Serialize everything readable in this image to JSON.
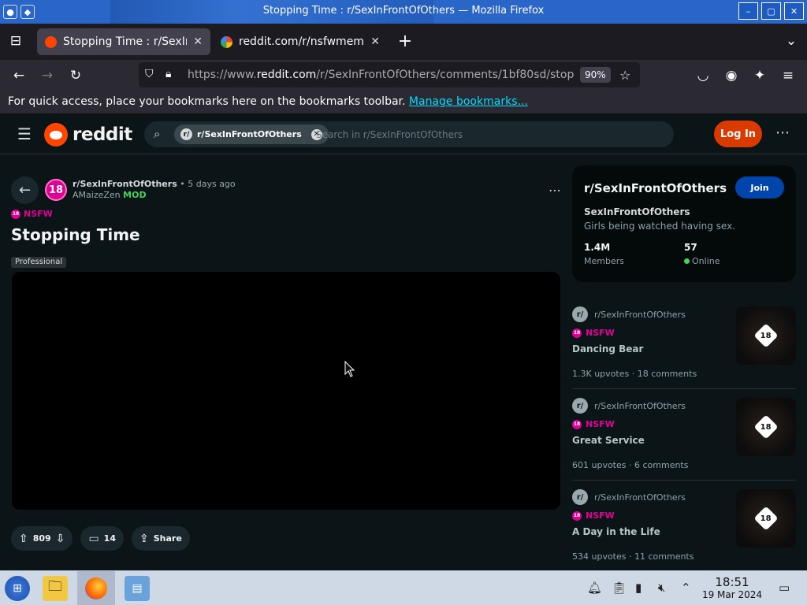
{
  "window": {
    "title": "Stopping Time : r/SexInFrontOfOthers — Mozilla Firefox",
    "controls": [
      "–",
      "▢",
      "✕"
    ]
  },
  "tabs": [
    {
      "label": "Stopping Time : r/SexInFr",
      "active": true,
      "favicon_color": "#ff4500"
    },
    {
      "label": "reddit.com/r/nsfwmeme",
      "active": false,
      "favicon_color": "#4285f4"
    }
  ],
  "nav": {
    "url_prefix": "https://www.",
    "url_domain": "reddit.com",
    "url_path": "/r/SexInFrontOfOthers/comments/1bf80sd/stop",
    "zoom": "90%"
  },
  "bookmarks_bar": {
    "text": "For quick access, place your bookmarks here on the bookmarks toolbar.",
    "link": "Manage bookmarks..."
  },
  "header": {
    "logo": "reddit",
    "search_chip": "r/SexInFrontOfOthers",
    "search_placeholder": "Search in r/SexInFrontOfOthers",
    "login": "Log In"
  },
  "post": {
    "avatar_text": "18",
    "subreddit": "r/SexInFrontOfOthers",
    "age": "• 5 days ago",
    "author": "AMaizeZen",
    "author_badge": "MOD",
    "nsfw": "NSFW",
    "title": "Stopping Time",
    "flair": "Professional",
    "upvotes": "809",
    "comments": "14",
    "share": "Share"
  },
  "sidebar": {
    "name": "r/SexInFrontOfOthers",
    "join": "Join",
    "display_name": "SexInFrontOfOthers",
    "description": "Girls being watched having sex.",
    "members_value": "1.4M",
    "members_label": "Members",
    "online_value": "57",
    "online_label": "Online"
  },
  "related": [
    {
      "subreddit": "r/SexInFrontOfOthers",
      "nsfw": "NSFW",
      "title": "Dancing Bear",
      "stats": "1.3K upvotes  ·  18 comments",
      "badge": "18"
    },
    {
      "subreddit": "r/SexInFrontOfOthers",
      "nsfw": "NSFW",
      "title": "Great Service",
      "stats": "601 upvotes  ·  6 comments",
      "badge": "18"
    },
    {
      "subreddit": "r/SexInFrontOfOthers",
      "nsfw": "NSFW",
      "title": "A Day in the Life",
      "stats": "534 upvotes  ·  11 comments",
      "badge": "18"
    }
  ],
  "taskbar": {
    "time": "18:51",
    "date": "19 Mar 2024"
  },
  "colors": {
    "titlebar": "#2a66c8",
    "reddit_bg": "#0b1416",
    "accent_orange": "#d93a00",
    "nsfw": "#e00096",
    "join_blue": "#0045ac"
  }
}
